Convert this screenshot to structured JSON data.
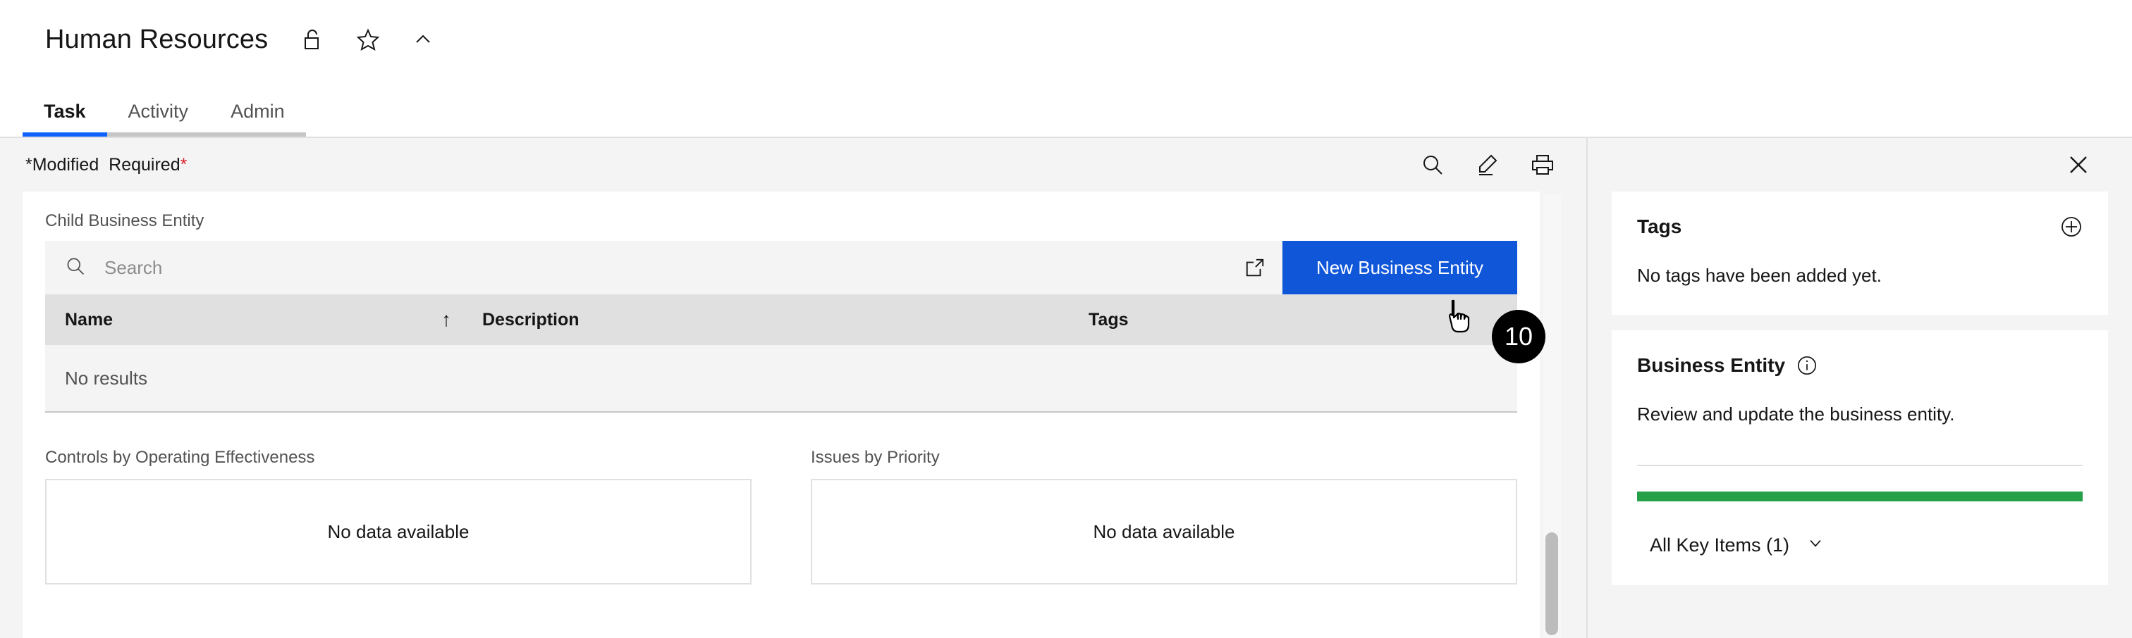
{
  "header": {
    "title": "Human Resources",
    "icons": [
      {
        "name": "unlock-icon"
      },
      {
        "name": "star-icon"
      },
      {
        "name": "chevron-up-icon"
      }
    ]
  },
  "tabs": [
    {
      "label": "Task",
      "active": true
    },
    {
      "label": "Activity",
      "active": false
    },
    {
      "label": "Admin",
      "active": false
    }
  ],
  "status_bar": {
    "modified_star": "*",
    "modified_label": "Modified",
    "required_label": "Required",
    "required_star": "*",
    "actions": [
      {
        "name": "search-icon"
      },
      {
        "name": "edit-icon"
      },
      {
        "name": "print-icon"
      }
    ]
  },
  "main": {
    "section_label": "Child Business Entity",
    "search": {
      "placeholder": "Search",
      "value": ""
    },
    "open_external_label": "Open in new window",
    "new_button_label": "New Business Entity",
    "table": {
      "columns": [
        "Name",
        "Description",
        "Tags"
      ],
      "sort_indicator": "↑",
      "empty_text": "No results",
      "rows": []
    },
    "charts": [
      {
        "title": "Controls by Operating Effectiveness",
        "empty_text": "No data available"
      },
      {
        "title": "Issues by Priority",
        "empty_text": "No data available"
      }
    ]
  },
  "right_panel": {
    "close_label": "Close",
    "tags_card": {
      "title": "Tags",
      "add_label": "Add tag",
      "body": "No tags have been added yet."
    },
    "entity_card": {
      "title": "Business Entity",
      "info_label": "More information",
      "body": "Review and update the business entity.",
      "progress_percent": 100,
      "key_items_label": "All Key Items (1)"
    }
  },
  "annotation": {
    "step_number": "10"
  },
  "colors": {
    "accent_blue": "#0f56d9",
    "tab_active": "#0f62fe",
    "required_red": "#da1e28",
    "progress_green": "#24a148",
    "badge_black": "#000000"
  }
}
